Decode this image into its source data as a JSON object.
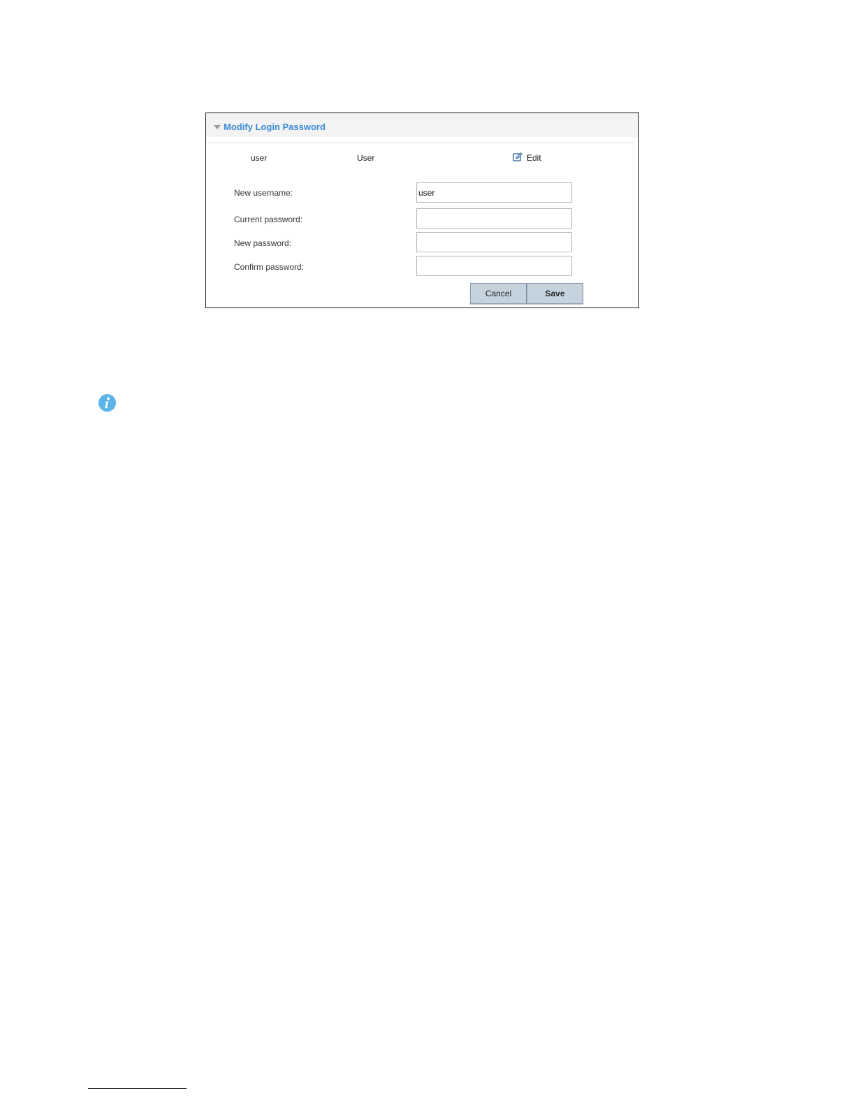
{
  "panel": {
    "title": "Modify Login Password",
    "summary": {
      "username": "user",
      "role": "User",
      "edit_label": "Edit"
    },
    "fields": {
      "new_username": {
        "label": "New username:",
        "value": "user"
      },
      "current_password": {
        "label": "Current password:",
        "value": ""
      },
      "new_password": {
        "label": "New password:",
        "value": ""
      },
      "confirm_password": {
        "label": "Confirm password:",
        "value": ""
      }
    },
    "buttons": {
      "cancel": "Cancel",
      "save": "Save"
    }
  },
  "colors": {
    "title_accent": "#3d8ad6",
    "button_bg": "#c5d3df",
    "info_icon": "#5ab4ea"
  },
  "icons": {
    "collapse": "caret-down-icon",
    "edit": "edit-icon",
    "note": "info-icon"
  }
}
